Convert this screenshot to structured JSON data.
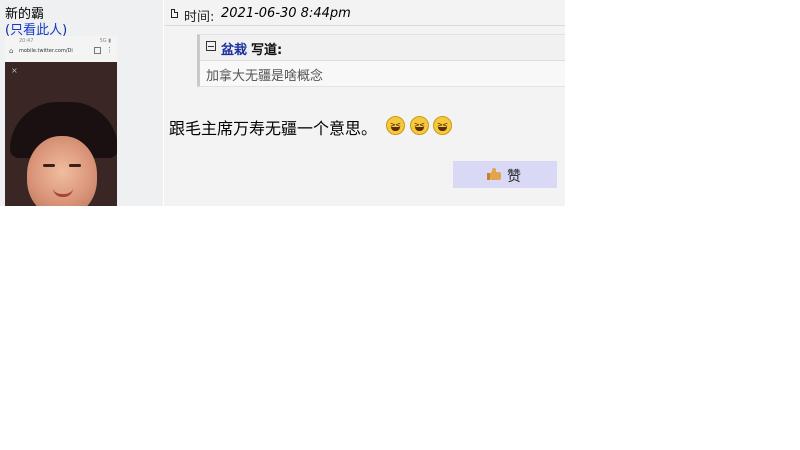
{
  "user": {
    "name": "新的霸",
    "only_this_prefix": "(",
    "only_this_link": "只看此人",
    "only_this_suffix": ")"
  },
  "avatar_screenshot": {
    "status_left": "20:47",
    "status_right": "5G ▮",
    "url": "mobile.twitter.com/Di",
    "close": "×"
  },
  "post": {
    "time_label": "时间:",
    "time_value": "2021-06-30 8:44pm",
    "quote": {
      "author": "盆栽",
      "wrote": "写道:",
      "text": "加拿大无疆是啥概念"
    },
    "body": "跟毛主席万寿无疆一个意思。",
    "emoji_icon": "laughing-squint-emoji",
    "like_label": "赞"
  },
  "colors": {
    "link": "#1538c4",
    "quote_author": "#1c2fa0",
    "like_bg": "#d9d9f6",
    "panel_bg": "#f3f3f3"
  }
}
